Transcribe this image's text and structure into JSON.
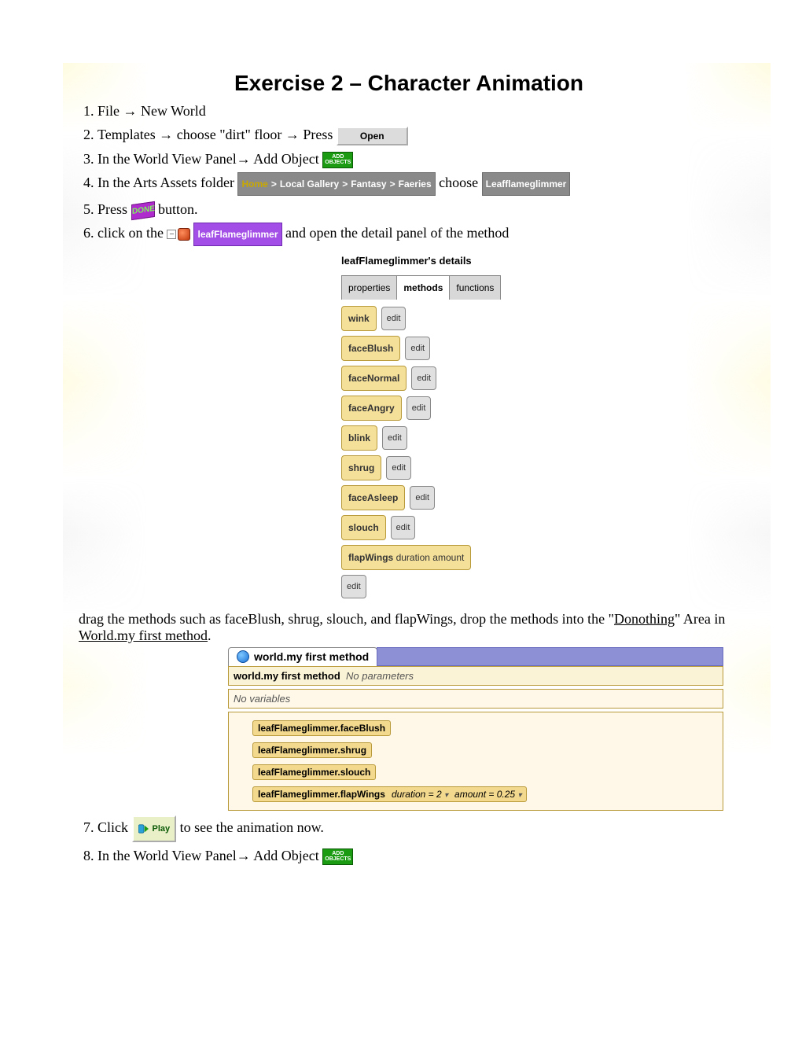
{
  "title": "Exercise 2 – Character Animation",
  "arrow": "→",
  "steps": {
    "s1a": "File ",
    "s1b": " New World",
    "s2a": "Templates ",
    "s2b": " choose \"dirt\" floor ",
    "s2c": "Press ",
    "s3a": "In the World View Panel",
    "s3b": " Add Object",
    "s4a": "In the Arts Assets folder ",
    "s4b": " choose",
    "s5a": "Press ",
    "s5b": " button.",
    "s6a": "click on the ",
    "s6b": " and open the detail panel of the method",
    "s7a": "Click ",
    "s7b": " to see the animation now.",
    "s8a": "In the World View Panel",
    "s8b": " Add Object"
  },
  "buttons": {
    "open": "Open",
    "addObjects1": "ADD",
    "addObjects2": "OBJECTS",
    "done": "DONE",
    "play": "Play"
  },
  "breadcrumb": {
    "home": "Home",
    "sep": ">",
    "a": "Local Gallery",
    "b": "Fantasy",
    "c": "Faeries"
  },
  "tags": {
    "leaf": "Leafflameglimmer",
    "leafPurple": "leafFlameglimmer"
  },
  "details": {
    "title": "leafFlameglimmer's details",
    "tabs": {
      "p": "properties",
      "m": "methods",
      "f": "functions"
    },
    "editLabel": "edit",
    "methods": [
      "wink",
      "faceBlush",
      "faceNormal",
      "faceAngry",
      "blink",
      "shrug",
      "faceAsleep",
      "slouch"
    ],
    "flap": {
      "name": "flapWings",
      "p1": "duration",
      "p2": "amount"
    }
  },
  "para": {
    "t1": "drag the methods such as faceBlush, shrug, slouch, and flapWings, drop the methods into the \"",
    "do": "Donothing",
    "t2": "\" Area in ",
    "wm": "World.my first method",
    "t3": "."
  },
  "editor": {
    "tab": "world.my first method",
    "header": "world.my first method",
    "noparams": "No parameters",
    "novars": "No variables",
    "calls": [
      "leafFlameglimmer.faceBlush",
      "leafFlameglimmer.shrug",
      "leafFlameglimmer.slouch"
    ],
    "flapCall": "leafFlameglimmer.flapWings",
    "dur": "duration = 2",
    "amt": "amount = 0.25"
  }
}
